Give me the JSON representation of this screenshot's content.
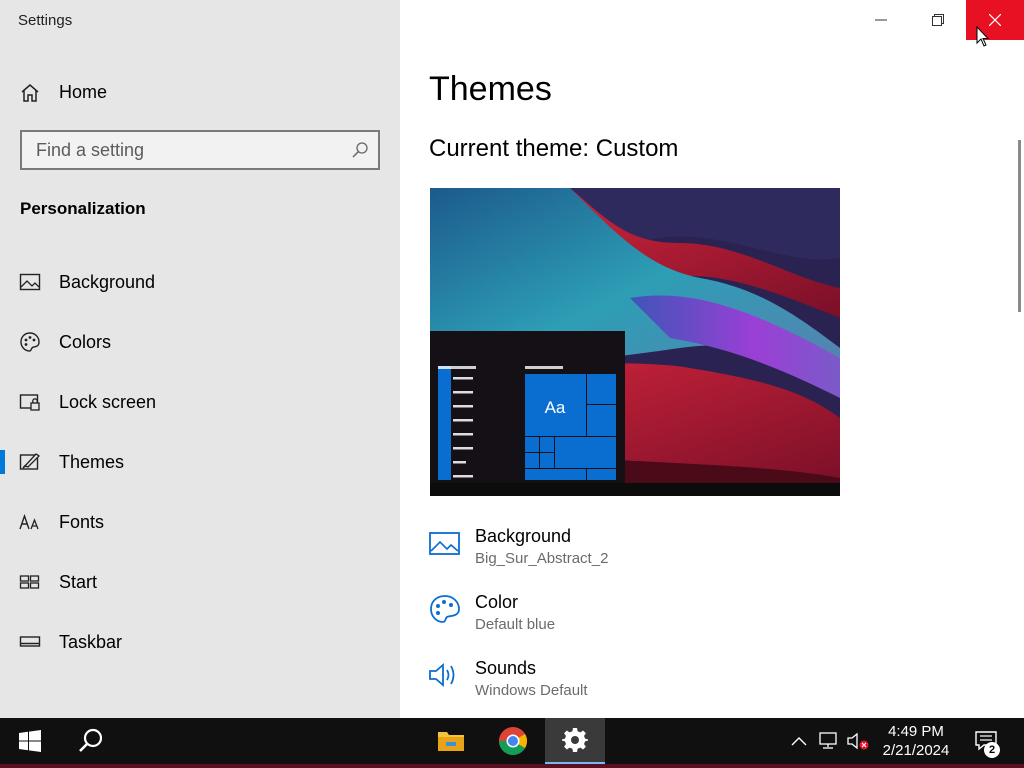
{
  "window": {
    "title": "Settings"
  },
  "sidebar": {
    "home_label": "Home",
    "search_placeholder": "Find a setting",
    "section_heading": "Personalization",
    "items": [
      {
        "label": "Background",
        "icon": "picture-icon"
      },
      {
        "label": "Colors",
        "icon": "palette-icon"
      },
      {
        "label": "Lock screen",
        "icon": "lock-screen-icon"
      },
      {
        "label": "Themes",
        "icon": "brush-icon",
        "selected": true
      },
      {
        "label": "Fonts",
        "icon": "fonts-icon"
      },
      {
        "label": "Start",
        "icon": "start-grid-icon"
      },
      {
        "label": "Taskbar",
        "icon": "taskbar-icon"
      }
    ]
  },
  "main": {
    "title": "Themes",
    "current_theme": "Current theme: Custom",
    "preview_sample_text": "Aa",
    "settings": [
      {
        "label": "Background",
        "value": "Big_Sur_Abstract_2",
        "icon": "picture-icon"
      },
      {
        "label": "Color",
        "value": "Default blue",
        "icon": "palette-icon"
      },
      {
        "label": "Sounds",
        "value": "Windows Default",
        "icon": "speaker-icon"
      }
    ]
  },
  "taskbar": {
    "time": "4:49 PM",
    "date": "2/21/2024",
    "notification_count": "2"
  },
  "colors": {
    "accent": "#0078d7",
    "close_hover": "#e81123",
    "sidebar_bg": "#e6e6e6"
  }
}
